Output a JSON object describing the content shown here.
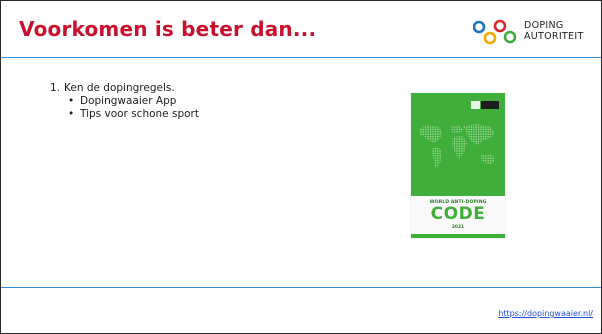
{
  "slide": {
    "title": "Voorkomen is beter dan...",
    "logo": {
      "line1": "DOPING",
      "line2": "AUTORITEIT"
    },
    "content": {
      "number": "1.",
      "item": "Ken de dopingregels.",
      "subitems": [
        "Dopingwaaier App",
        "Tips voor schone sport"
      ]
    },
    "book_cover": {
      "subtitle": "WORLD ANTI-DOPING",
      "title": "CODE",
      "year": "2021"
    },
    "footer_link": "https://dopingwaaier.nl/"
  },
  "colors": {
    "title": "#c8102e",
    "rule": "#2f8fd9",
    "book_green": "#3fae3a",
    "link": "#1f4fd8"
  }
}
